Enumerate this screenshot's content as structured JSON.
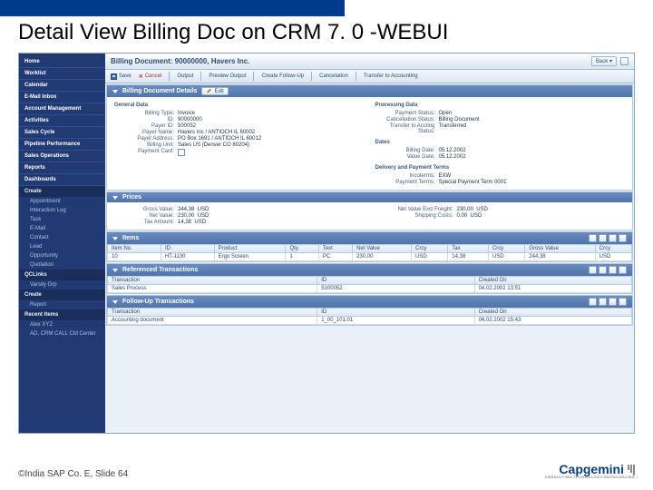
{
  "slide": {
    "title": "Detail View Billing Doc on CRM 7. 0 -WEBUI",
    "footer": "©India SAP Co. E, Slide 64",
    "logo": "Capgemini",
    "logo_tag": "CONSULTING.TECHNOLOGY.OUTSOURCING"
  },
  "header": {
    "title": "Billing Document: 90000000, Havers Inc.",
    "back": "Back"
  },
  "toolbar": {
    "save": "Save",
    "cancel": "Cancel",
    "output": "Output",
    "preview": "Preview Output",
    "followup": "Create Follow-Up",
    "cancelation": "Cancelation",
    "transfer": "Transfer to Accounting"
  },
  "sidebar": {
    "items": [
      "Home",
      "Worklist",
      "Calendar",
      "E-Mail Inbox",
      "Account Management",
      "Activities",
      "Sales Cycle",
      "Pipeline Performance",
      "Sales Operations",
      "Reports",
      "Dashboards"
    ],
    "create_head": "Create",
    "create_items": [
      "Appointment",
      "Interaction Log",
      "Task",
      "E-Mail",
      "Contact",
      "Lead",
      "Opportunity",
      "Quotation"
    ],
    "qclinks_head": "QCLinks",
    "qclinks_items": [
      "Varsity Grp"
    ],
    "create2_head": "Create",
    "create2_items": [
      "Report"
    ],
    "recent_head": "Recent Items",
    "recent_items": [
      "Alex XYZ",
      "AD, CRM CALL Ctd Center"
    ]
  },
  "details": {
    "panel_title": "Billing Document Details",
    "edit": "Edit",
    "general_head": "General Data",
    "general": {
      "billing_type_k": "Billing Type:",
      "billing_type_v": "Invoice",
      "id_k": "ID:",
      "id_v": "90000000",
      "payer_id_k": "Payer ID:",
      "payer_id_v": "500052",
      "payer_name_k": "Payer Name:",
      "payer_name_v": "Havers Inc / ANTIOCH IL 60002",
      "payer_addr_k": "Payer Address:",
      "payer_addr_v": "PO Box 1691 / ANTIOCH IL 60012",
      "billing_unit_k": "Billing Unit:",
      "billing_unit_v": "Sales US (Denver CO 80204)",
      "payment_card_k": "Payment Card:"
    },
    "processing_head": "Processing Data",
    "processing": {
      "pay_status_k": "Payment Status:",
      "pay_status_v": "Open",
      "cancel_status_k": "Cancellation Status:",
      "cancel_status_v": "Billing Document",
      "transfer_status_k": "Transfer to Accting Status:",
      "transfer_status_v": "Transferred"
    },
    "dates_head": "Dates",
    "dates": {
      "billing_date_k": "Billing Date:",
      "billing_date_v": "05.12.2002",
      "value_date_k": "Value Date:",
      "value_date_v": "05.12.2002"
    },
    "dpt_head": "Delivery and Payment Terms",
    "dpt": {
      "inco_k": "Incoterms:",
      "inco_v": "EXW",
      "payterm_k": "Payment Terms:",
      "payterm_v": "Special Payment Term 0001"
    }
  },
  "prices": {
    "panel_title": "Prices",
    "gross_k": "Gross Value:",
    "gross_v": "244,38",
    "gross_c": "USD",
    "net_k": "Net Value:",
    "net_v": "230,00",
    "net_c": "USD",
    "tax_k": "Tax Amount:",
    "tax_v": "14,38",
    "tax_c": "USD",
    "nvef_k": "Net Value Excl Freight:",
    "nvef_v": "230,00",
    "nvef_c": "USD",
    "ship_k": "Shipping Costs:",
    "ship_v": "0,00",
    "ship_c": "USD"
  },
  "items": {
    "panel_title": "Items",
    "cols": [
      "Item No.",
      "ID",
      "Product",
      "Qty.",
      "Text",
      "Net Value",
      "Crcy",
      "Tax",
      "Crcy",
      "Gross Value",
      "Crcy"
    ],
    "row": [
      "10",
      "HT-1130",
      "Ergo Screen",
      "1",
      "PC",
      "230,00",
      "USD",
      "14,38",
      "USD",
      "244,38",
      "USD"
    ]
  },
  "ref": {
    "panel_title": "Referenced Transactions",
    "cols": [
      "Transaction",
      "ID",
      "Created On"
    ],
    "row": [
      "Sales Process",
      "5100052",
      "04.02.2002 13:51"
    ]
  },
  "fup": {
    "panel_title": "Follow-Up Transactions",
    "cols": [
      "Transaction",
      "ID",
      "Created On"
    ],
    "row": [
      "Accounting document",
      "1_00_101.01",
      "04.02.2002 15:43"
    ]
  }
}
